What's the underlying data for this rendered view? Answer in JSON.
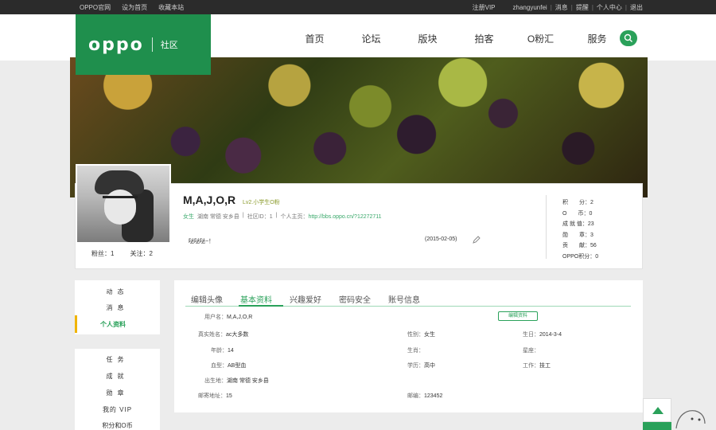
{
  "topbar": {
    "left": [
      "OPPO官网",
      "设为首页",
      "收藏本站"
    ],
    "vip": "注册VIP",
    "username": "zhangyunfei",
    "links": [
      "消息",
      "提醒",
      "个人中心",
      "退出"
    ]
  },
  "logo": {
    "brand": "oppo",
    "sub": "社区"
  },
  "nav": [
    "首页",
    "论坛",
    "版块",
    "拍客",
    "O粉汇",
    "服务"
  ],
  "profile": {
    "name": "M,A,J,O,R",
    "level": "Lv2.小学生O粉",
    "gender": "女生",
    "location": "湖南 常德 安乡县",
    "community_id_label": "社区ID：",
    "community_id": "1",
    "homepage_label": "个人主页：",
    "homepage_url": "http://bbs.oppo.cn/?12272711",
    "signature": "哒哒哒~！",
    "signature_date": "(2015-02-05)",
    "fans_label": "粉丝：",
    "fans": "1",
    "follow_label": "关注：",
    "follow": "2"
  },
  "stats": [
    {
      "label": "积　　分：",
      "value": "2"
    },
    {
      "label": "O　　币：",
      "value": "0"
    },
    {
      "label": "成 就 值：",
      "value": "23"
    },
    {
      "label": "勋　　章：",
      "value": "3"
    },
    {
      "label": "贡　　献：",
      "value": "56"
    },
    {
      "label": "OPPO积分：",
      "value": "0"
    }
  ],
  "sidebar1": [
    "动态",
    "消息",
    "个人资料"
  ],
  "sidebar2": [
    "任务",
    "成就",
    "勋章",
    "我的 VIP",
    "积分和O币"
  ],
  "tabs": [
    "编辑头像",
    "基本资料",
    "兴趣爱好",
    "密码安全",
    "账号信息"
  ],
  "edit_button": "编辑资料",
  "fields": {
    "username": {
      "k": "用户名：",
      "v": "M,A,J,O,R"
    },
    "realname": {
      "k": "真实姓名：",
      "v": "ac大多数"
    },
    "gender": {
      "k": "性别：",
      "v": "女生"
    },
    "birthday": {
      "k": "生日：",
      "v": "2014-3-4"
    },
    "age": {
      "k": "年龄：",
      "v": "14"
    },
    "zodiac": {
      "k": "生肖：",
      "v": ""
    },
    "constellation": {
      "k": "星座：",
      "v": ""
    },
    "blood": {
      "k": "血型：",
      "v": "AB型血"
    },
    "education": {
      "k": "学历：",
      "v": "高中"
    },
    "work": {
      "k": "工作：",
      "v": "技工"
    },
    "birthplace": {
      "k": "出生地：",
      "v": "湖南 常德 安乡县"
    },
    "address": {
      "k": "邮寄地址：",
      "v": "15"
    },
    "postcode": {
      "k": "邮编：",
      "v": "123452"
    }
  },
  "colors": {
    "brand_green": "#2aa15a",
    "logo_green": "#1f8f4d",
    "topbar": "#2b2b2b"
  },
  "icons": [
    "search-icon",
    "pencil-icon",
    "arrow-up-icon"
  ]
}
